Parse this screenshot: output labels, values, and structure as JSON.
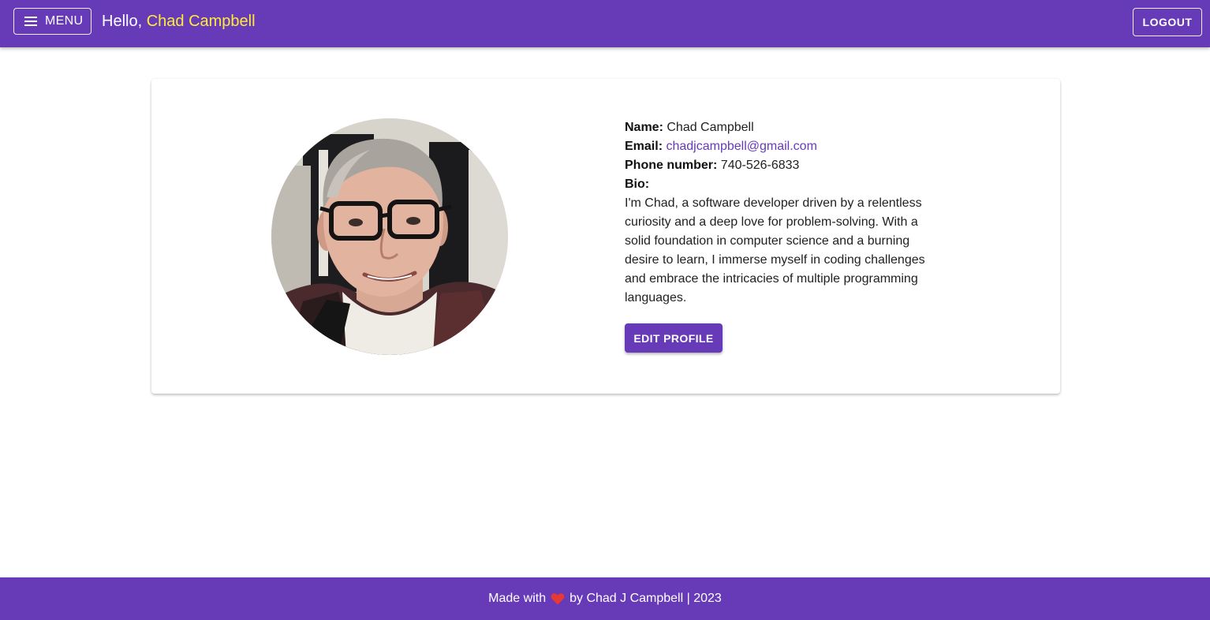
{
  "header": {
    "menu_label": "MENU",
    "menu_icon": "hamburger-menu-icon",
    "greeting_prefix": "Hello, ",
    "user_name": "Chad Campbell",
    "logout_label": "LOGOUT"
  },
  "profile": {
    "name_label": "Name:",
    "name_value": "Chad Campbell",
    "email_label": "Email:",
    "email_value": "chadjcampbell@gmail.com",
    "phone_label": "Phone number:",
    "phone_value": "740-526-6833",
    "bio_label": "Bio:",
    "bio_value": "I'm Chad, a software developer driven by a relentless curiosity and a deep love for problem-solving. With a solid foundation in computer science and a burning desire to learn, I immerse myself in coding challenges and embrace the intricacies of multiple programming languages.",
    "edit_button_label": "EDIT PROFILE",
    "avatar_icon": "profile-photo"
  },
  "footer": {
    "text_before": "Made with",
    "heart_icon": "heart-icon",
    "text_after": "by Chad J Campbell | 2023"
  },
  "colors": {
    "primary": "#673ab7",
    "accent_name": "#ffeb3b",
    "heart": "#e53935"
  }
}
